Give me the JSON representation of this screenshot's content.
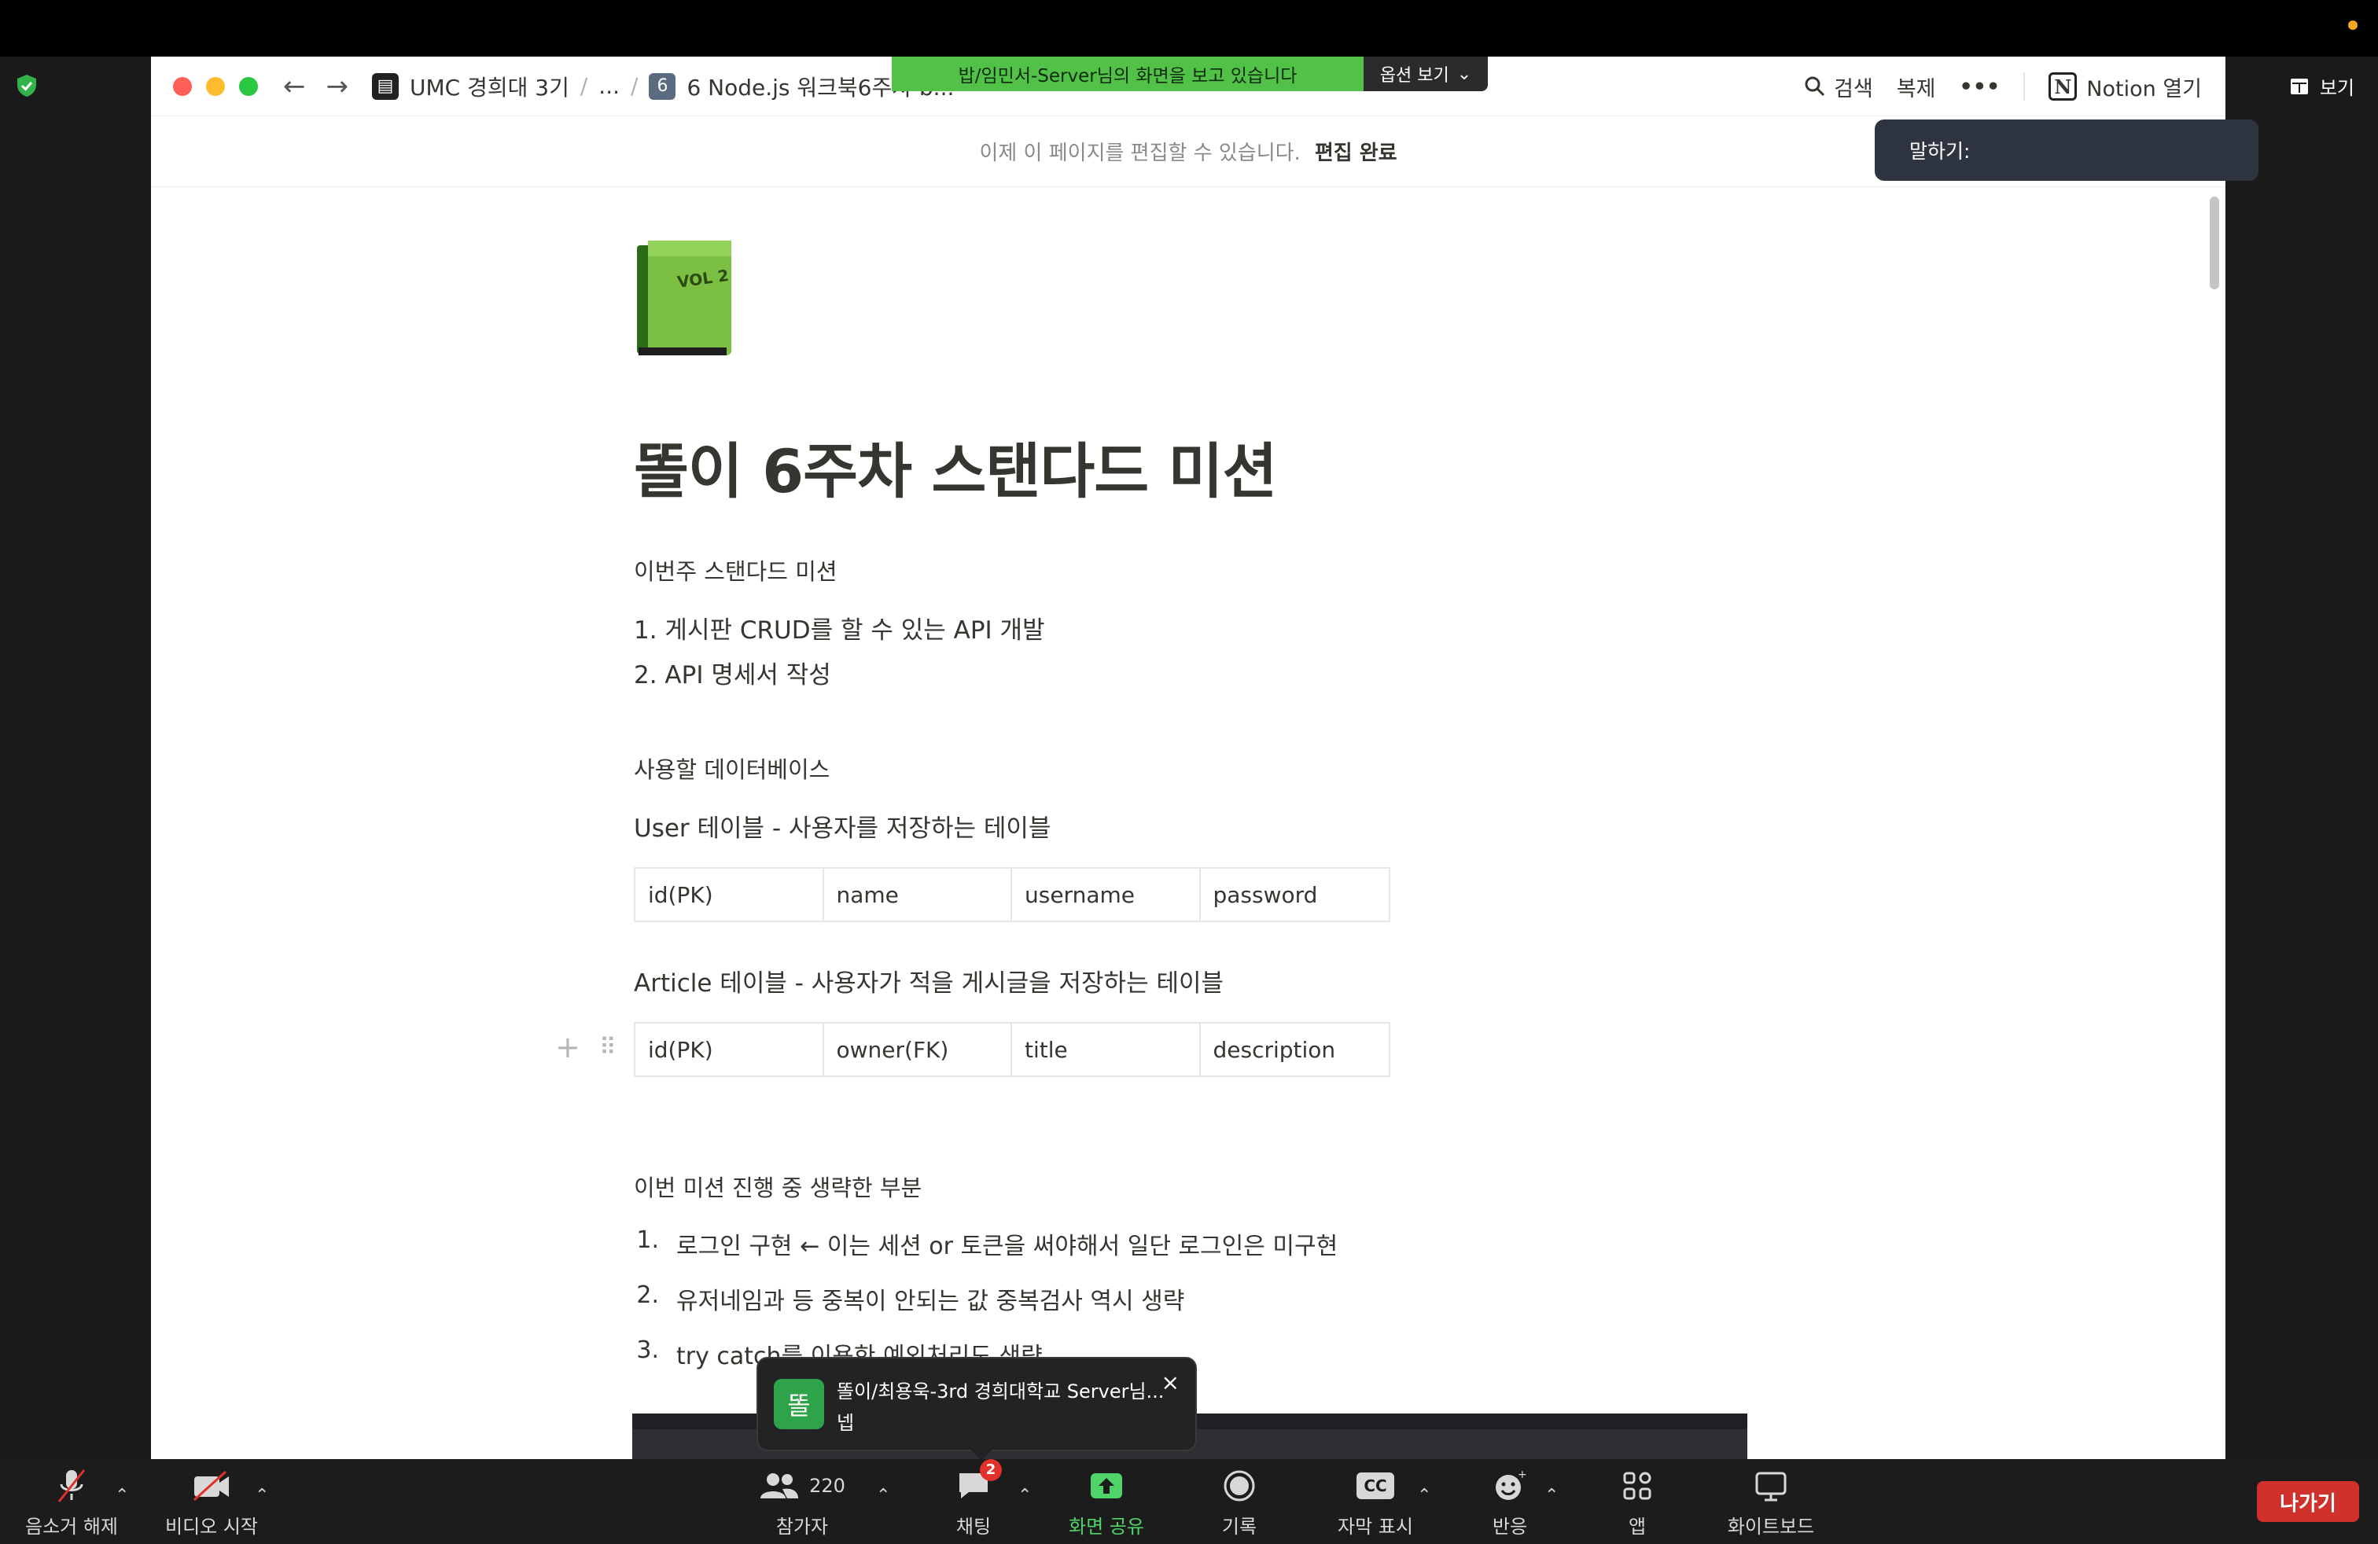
{
  "colors": {
    "share_green": "#51c247",
    "notion_text": "#37352f",
    "leave_red": "#d0312d",
    "screen_share_green": "#4fd46a",
    "traffic_red": "#ff5f57",
    "traffic_yellow": "#febc2e",
    "traffic_green": "#28c840"
  },
  "zoom": {
    "view_label": "보기",
    "share_banner": "밥/임민서-Server님의 화면을 보고 있습니다",
    "share_options": "옵션 보기",
    "speak_popup": "말하기:"
  },
  "browser": {
    "breadcrumbs": [
      {
        "label": "UMC 경희대 3기",
        "icon": "notebook-icon"
      },
      {
        "label": "..."
      },
      {
        "label": "6 Node.js 워크북6주차 b...",
        "icon": "number-6-icon"
      }
    ],
    "search_label": "검색",
    "duplicate_label": "복제",
    "more_label": "•••",
    "open_notion_label": "Notion 열기",
    "edit_notice": "이제 이 페이지를 편집할 수 있습니다.",
    "edit_done": "편집 완료"
  },
  "page": {
    "title": "똘이 6주차 스탠다드 미션",
    "section_mission": "이번주 스탠다드 미션",
    "mission_items": [
      "1. 게시판 CRUD를 할 수 있는 API 개발",
      "2. API 명세서 작성"
    ],
    "section_db": "사용할 데이터베이스",
    "user_table_title": "User 테이블 - 사용자를 저장하는 테이블",
    "user_table": [
      "id(PK)",
      "name",
      "username",
      "password"
    ],
    "article_table_title": "Article 테이블 - 사용자가 적을 게시글을 저장하는 테이블",
    "article_table": [
      "id(PK)",
      "owner(FK)",
      "title",
      "description"
    ],
    "section_omitted": "이번 미션 진행 중 생략한 부분",
    "omitted_items": [
      {
        "num": "1.",
        "text": "로그인 구현 ← 이는 세션 or 토큰을 써야해서 일단 로그인은 미구현"
      },
      {
        "num": "2.",
        "text": "유저네임과 등 중복이 안되는 값 중복검사 역시 생략"
      },
      {
        "num": "3.",
        "text": "try catch를 이용한 예외처리도 생략"
      }
    ]
  },
  "chat_toast": {
    "avatar_text": "똘",
    "sender": "똘이/최용욱-3rd 경희대학교 Server님...",
    "message": "넵",
    "close": "×"
  },
  "toolbar": {
    "unmute": "음소거 해제",
    "start_video": "비디오 시작",
    "participants_count": "220",
    "participants": "참가자",
    "chat": "채팅",
    "chat_badge": "2",
    "share_screen": "화면 공유",
    "record": "기록",
    "captions_icon_text": "CC",
    "captions": "자막 표시",
    "reactions": "반응",
    "apps": "앱",
    "whiteboard": "화이트보드",
    "leave": "나가기"
  }
}
